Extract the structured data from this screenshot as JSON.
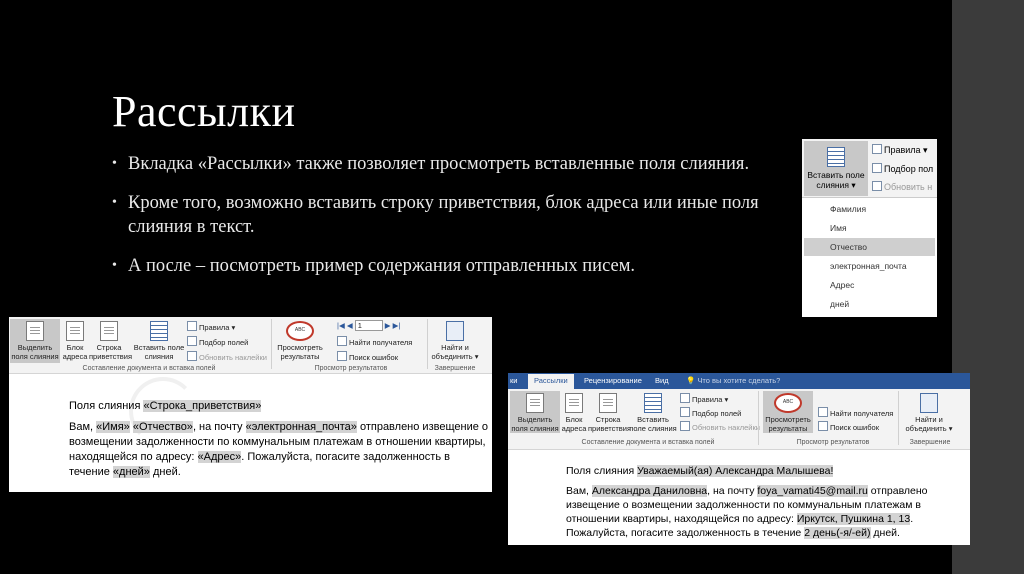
{
  "slide": {
    "title": "Рассылки",
    "bullets": [
      "Вкладка «Рассылки» также позволяет просмотреть вставленные поля слияния.",
      "Кроме того, возможно вставить строку приветствия, блок адреса или иные поля слияния в текст.",
      "А после – посмотреть пример содержания отправленных писем."
    ]
  },
  "ribbon1": {
    "highlight_label": "Выделить поля слияния",
    "address_block_label": "Блок адреса",
    "greeting_label": "Строка приветствия",
    "insert_field_label": "Вставить поле слияния",
    "rules_label": "Правила",
    "match_fields_label": "Подбор полей",
    "update_labels_label": "Обновить наклейки",
    "group_compose": "Составление документа и вставка полей",
    "preview_label": "Просмотреть результаты",
    "record_number": "1",
    "find_recipient_label": "Найти получателя",
    "check_errors_label": "Поиск ошибок",
    "group_preview": "Просмотр результатов",
    "finish_label": "Найти и объединить",
    "group_finish": "Завершение"
  },
  "doc1": {
    "line1_prefix": "Поля слияния",
    "line1_field": "«Строка_приветствия»",
    "p_start": "Вам,",
    "f_name": "«Имя»",
    "f_patronymic": "«Отчество»",
    "p_mid1": ", на почту",
    "f_email": "«электронная_почта»",
    "p_mid2": "отправлено извещение о возмещении задолженности по коммунальным платежам в отношении квартиры, находящейся по адресу:",
    "f_address": "«Адрес»",
    "p_mid3": ". Пожалуйста, погасите задолженность в течение",
    "f_days": "«дней»",
    "p_end": "дней."
  },
  "ribbon2": {
    "tabs": [
      "ки",
      "Рассылки",
      "Рецензирование",
      "Вид",
      "Что вы хотите сделать?"
    ],
    "highlight_label": "Выделить поля слияния",
    "address_block_label": "Блок адреса",
    "greeting_label": "Строка приветствия",
    "insert_field_label": "Вставить поле слияния",
    "rules_label": "Правила",
    "match_fields_label": "Подбор полей",
    "update_labels_label": "Обновить наклейки",
    "group_compose": "Составление документа и вставка полей",
    "preview_label": "Просмотреть результаты",
    "find_recipient_label": "Найти получателя",
    "check_errors_label": "Поиск ошибок",
    "group_preview": "Просмотр результатов",
    "finish_label": "Найти и объединить",
    "group_finish": "Завершение"
  },
  "doc2": {
    "line1_prefix": "Поля слияния",
    "line1_field": "Уважаемый(ая) Александра Малышева!",
    "p_start": "Вам,",
    "f_name": "Александра Даниловна",
    "p_mid1": ", на почту",
    "f_email": "foya_vamati45@mail.ru",
    "p_mid2": "отправлено извещение о возмещении задолженности по коммунальным платежам в отношении квартиры, находящейся по адресу:",
    "f_address": "Иркутск, Пушкина 1, 13",
    "p_mid3": ". Пожалуйста, погасите задолженность в течение",
    "f_days": "2 день(-я/-ей)",
    "p_end": "дней."
  },
  "dropdown": {
    "insert_label": "Вставить поле слияния",
    "rules_label": "Правила",
    "match_fields_label": "Подбор пол",
    "update_label": "Обновить н",
    "items": [
      "Фамилия",
      "Имя",
      "Отчество",
      "электронная_почта",
      "Адрес",
      "дней"
    ],
    "selected_item": "Отчество"
  },
  "colors": {
    "background": "#000000",
    "word_blue": "#2b579a",
    "highlight": "#c8c8c8"
  }
}
